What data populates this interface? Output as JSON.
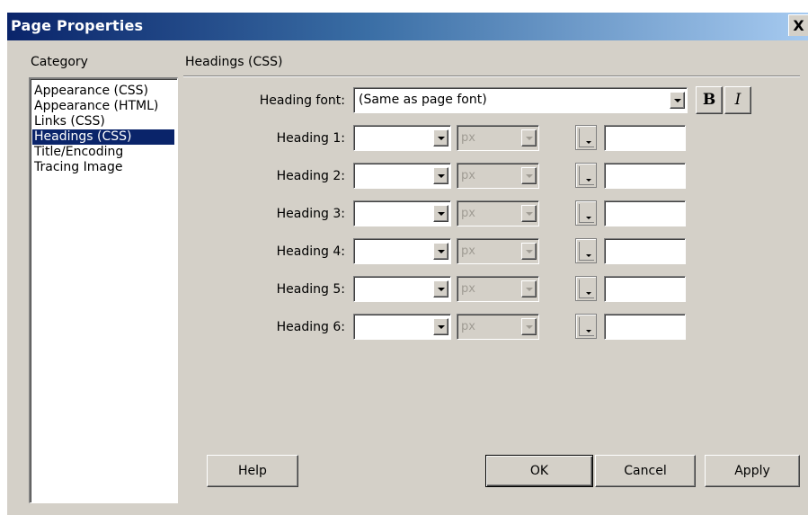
{
  "dialog": {
    "title": "Page Properties",
    "close_glyph": "X"
  },
  "category": {
    "label": "Category",
    "items": [
      {
        "label": "Appearance (CSS)",
        "selected": false
      },
      {
        "label": "Appearance (HTML)",
        "selected": false
      },
      {
        "label": "Links (CSS)",
        "selected": false
      },
      {
        "label": "Headings (CSS)",
        "selected": true
      },
      {
        "label": "Title/Encoding",
        "selected": false
      },
      {
        "label": "Tracing Image",
        "selected": false
      }
    ]
  },
  "section": {
    "title": "Headings (CSS)"
  },
  "heading_font": {
    "label": "Heading font:",
    "value": "(Same as page font)",
    "bold_label": "B",
    "italic_label": "I"
  },
  "headings": [
    {
      "label": "Heading 1:",
      "size": "",
      "unit": "px",
      "color": ""
    },
    {
      "label": "Heading 2:",
      "size": "",
      "unit": "px",
      "color": ""
    },
    {
      "label": "Heading 3:",
      "size": "",
      "unit": "px",
      "color": ""
    },
    {
      "label": "Heading 4:",
      "size": "",
      "unit": "px",
      "color": ""
    },
    {
      "label": "Heading 5:",
      "size": "",
      "unit": "px",
      "color": ""
    },
    {
      "label": "Heading 6:",
      "size": "",
      "unit": "px",
      "color": ""
    }
  ],
  "buttons": {
    "help": "Help",
    "ok": "OK",
    "cancel": "Cancel",
    "apply": "Apply"
  },
  "colors": {
    "face": "#d4d0c8",
    "selection": "#0a246a",
    "title_start": "#0a246a",
    "title_end": "#a6caf0"
  }
}
